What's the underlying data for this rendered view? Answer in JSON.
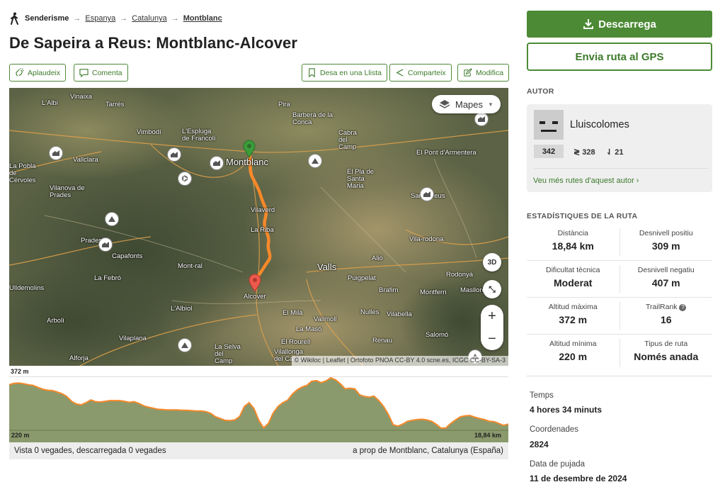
{
  "breadcrumb": {
    "activity": "Senderisme",
    "items": [
      "Espanya",
      "Catalunya",
      "Montblanc"
    ]
  },
  "title": "De Sapeira a Reus: Montblanc-Alcover",
  "actions": {
    "applaud": "Aplaudeix",
    "comment": "Comenta",
    "save_list": "Desa en una Llista",
    "share": "Comparteix",
    "edit": "Modifica"
  },
  "map": {
    "layers_label": "Mapes",
    "btn_3d": "3D",
    "zoom_in": "+",
    "zoom_out": "−",
    "attribution": "© Wikiloc | Leaflet | Ortofoto PNOA CC-BY 4.0 scne.es, ICGC CC-BY-SA-3",
    "labels": [
      "L'Albi",
      "Vinaixa",
      "Tarrés",
      "Pira",
      "Barberà de la Conca",
      "Vimbodí",
      "L'Espluga de Francolí",
      "Montblanc",
      "Cabra del Camp",
      "El Pont d'Armentera",
      "Vallclara",
      "La Pobla de Cérvoles",
      "Vilanova de Prades",
      "El Pla de Santa Maria",
      "Sant... reus",
      "Vilaverd",
      "La Riba",
      "Prades",
      "Capafonts",
      "Vila-rodona",
      "Valls",
      "Alió",
      "Mont-ral",
      "La Febró",
      "Puigpelat",
      "Rodonyà",
      "Alcover",
      "Brafim",
      "Montferri",
      "Masllorenç",
      "Ulldemolins",
      "L'Albiol",
      "El Milà",
      "Vallmoll",
      "Nulles",
      "Vilabella",
      "Arbolí",
      "La Masó",
      "Vilaplana",
      "La Selva del Camp",
      "El Rourell",
      "Renau",
      "Salomó",
      "Alforja",
      "Vilallonga del Camp"
    ]
  },
  "profile": {
    "max_label": "372 m",
    "min_label": "220 m",
    "dist_label": "18,84 km",
    "elevations": [
      352,
      356,
      357,
      355,
      352,
      350,
      344,
      339,
      336,
      335,
      331,
      326,
      318,
      304,
      296,
      294,
      300,
      308,
      303,
      302,
      304,
      306,
      306,
      306,
      304,
      301,
      303,
      298,
      291,
      287,
      284,
      281,
      280,
      279,
      279,
      279,
      278,
      278,
      277,
      276,
      276,
      274,
      269,
      259,
      254,
      249,
      248,
      250,
      260,
      289,
      300,
      283,
      249,
      227,
      240,
      270,
      289,
      300,
      307,
      325,
      337,
      345,
      350,
      362,
      364,
      358,
      363,
      372,
      366,
      355,
      340,
      342,
      340,
      323,
      318,
      316,
      319,
      306,
      289,
      266,
      236,
      232,
      238,
      246,
      249,
      251,
      252,
      250,
      246,
      237,
      226,
      227,
      240,
      250,
      259,
      262,
      263,
      258,
      254,
      251,
      246,
      245,
      240,
      234,
      238
    ]
  },
  "footer": {
    "views": "Vista 0 vegades, descarregada 0 vegades",
    "near": "a prop de Montblanc, Catalunya (España)"
  },
  "sidebar": {
    "download": "Descarrega",
    "gps": "Envia ruta al GPS",
    "author_heading": "AUTOR",
    "author_name": "Lluiscolomes",
    "author_points": "342",
    "author_trails": "328",
    "author_followers": "21",
    "author_more": "Veu més rutes d'aquest autor ›",
    "stats_heading": "ESTADÍSTIQUES DE LA RUTA",
    "stats": [
      {
        "label": "Distància",
        "value": "18,84 km"
      },
      {
        "label": "Desnivell positiu",
        "value": "309 m"
      },
      {
        "label": "Dificultat tècnica",
        "value": "Moderat"
      },
      {
        "label": "Desnivell negatiu",
        "value": "407 m"
      },
      {
        "label": "Altitud màxima",
        "value": "372 m"
      },
      {
        "label": "TrailRank",
        "value": "16"
      },
      {
        "label": "Altitud mínima",
        "value": "220 m"
      },
      {
        "label": "Tipus de ruta",
        "value": "Només anada"
      }
    ],
    "time_label": "Temps",
    "time_value": "4 hores 34 minuts",
    "coords_label": "Coordenades",
    "coords_value": "2824",
    "upload_label": "Data de pujada",
    "upload_value": "11 de desembre de 2024"
  },
  "colors": {
    "accent": "#4c8a35",
    "route": "#f7892a",
    "profile_fill": "#8a9a6c"
  }
}
